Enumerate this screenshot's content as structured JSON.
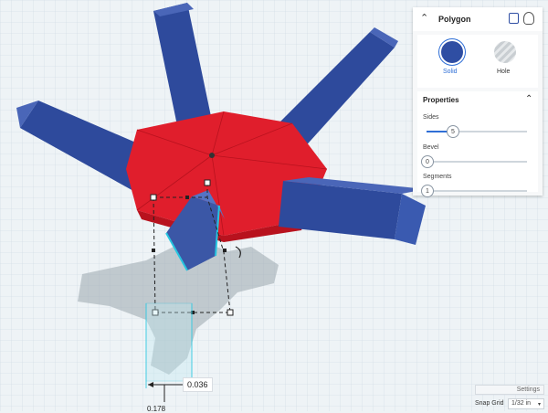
{
  "shape_panel": {
    "title": "Polygon",
    "solid_label": "Solid",
    "hole_label": "Hole",
    "colors": {
      "solid": "#2f4ea3",
      "accent": "#2f6fd6"
    }
  },
  "properties": {
    "title": "Properties",
    "sides": {
      "label": "Sides",
      "value": "5"
    },
    "bevel": {
      "label": "Bevel",
      "value": "0"
    },
    "segments": {
      "label": "Segments",
      "value": "1"
    }
  },
  "dimension": {
    "value": "0.036",
    "cut_value": "0.178"
  },
  "footer": {
    "settings_label": "Settings",
    "snap_grid_label": "Snap Grid",
    "snap_value": "1/32 in"
  },
  "colors": {
    "red_shape": "#e01e2c",
    "blue_bars": "#2e4a9c"
  }
}
